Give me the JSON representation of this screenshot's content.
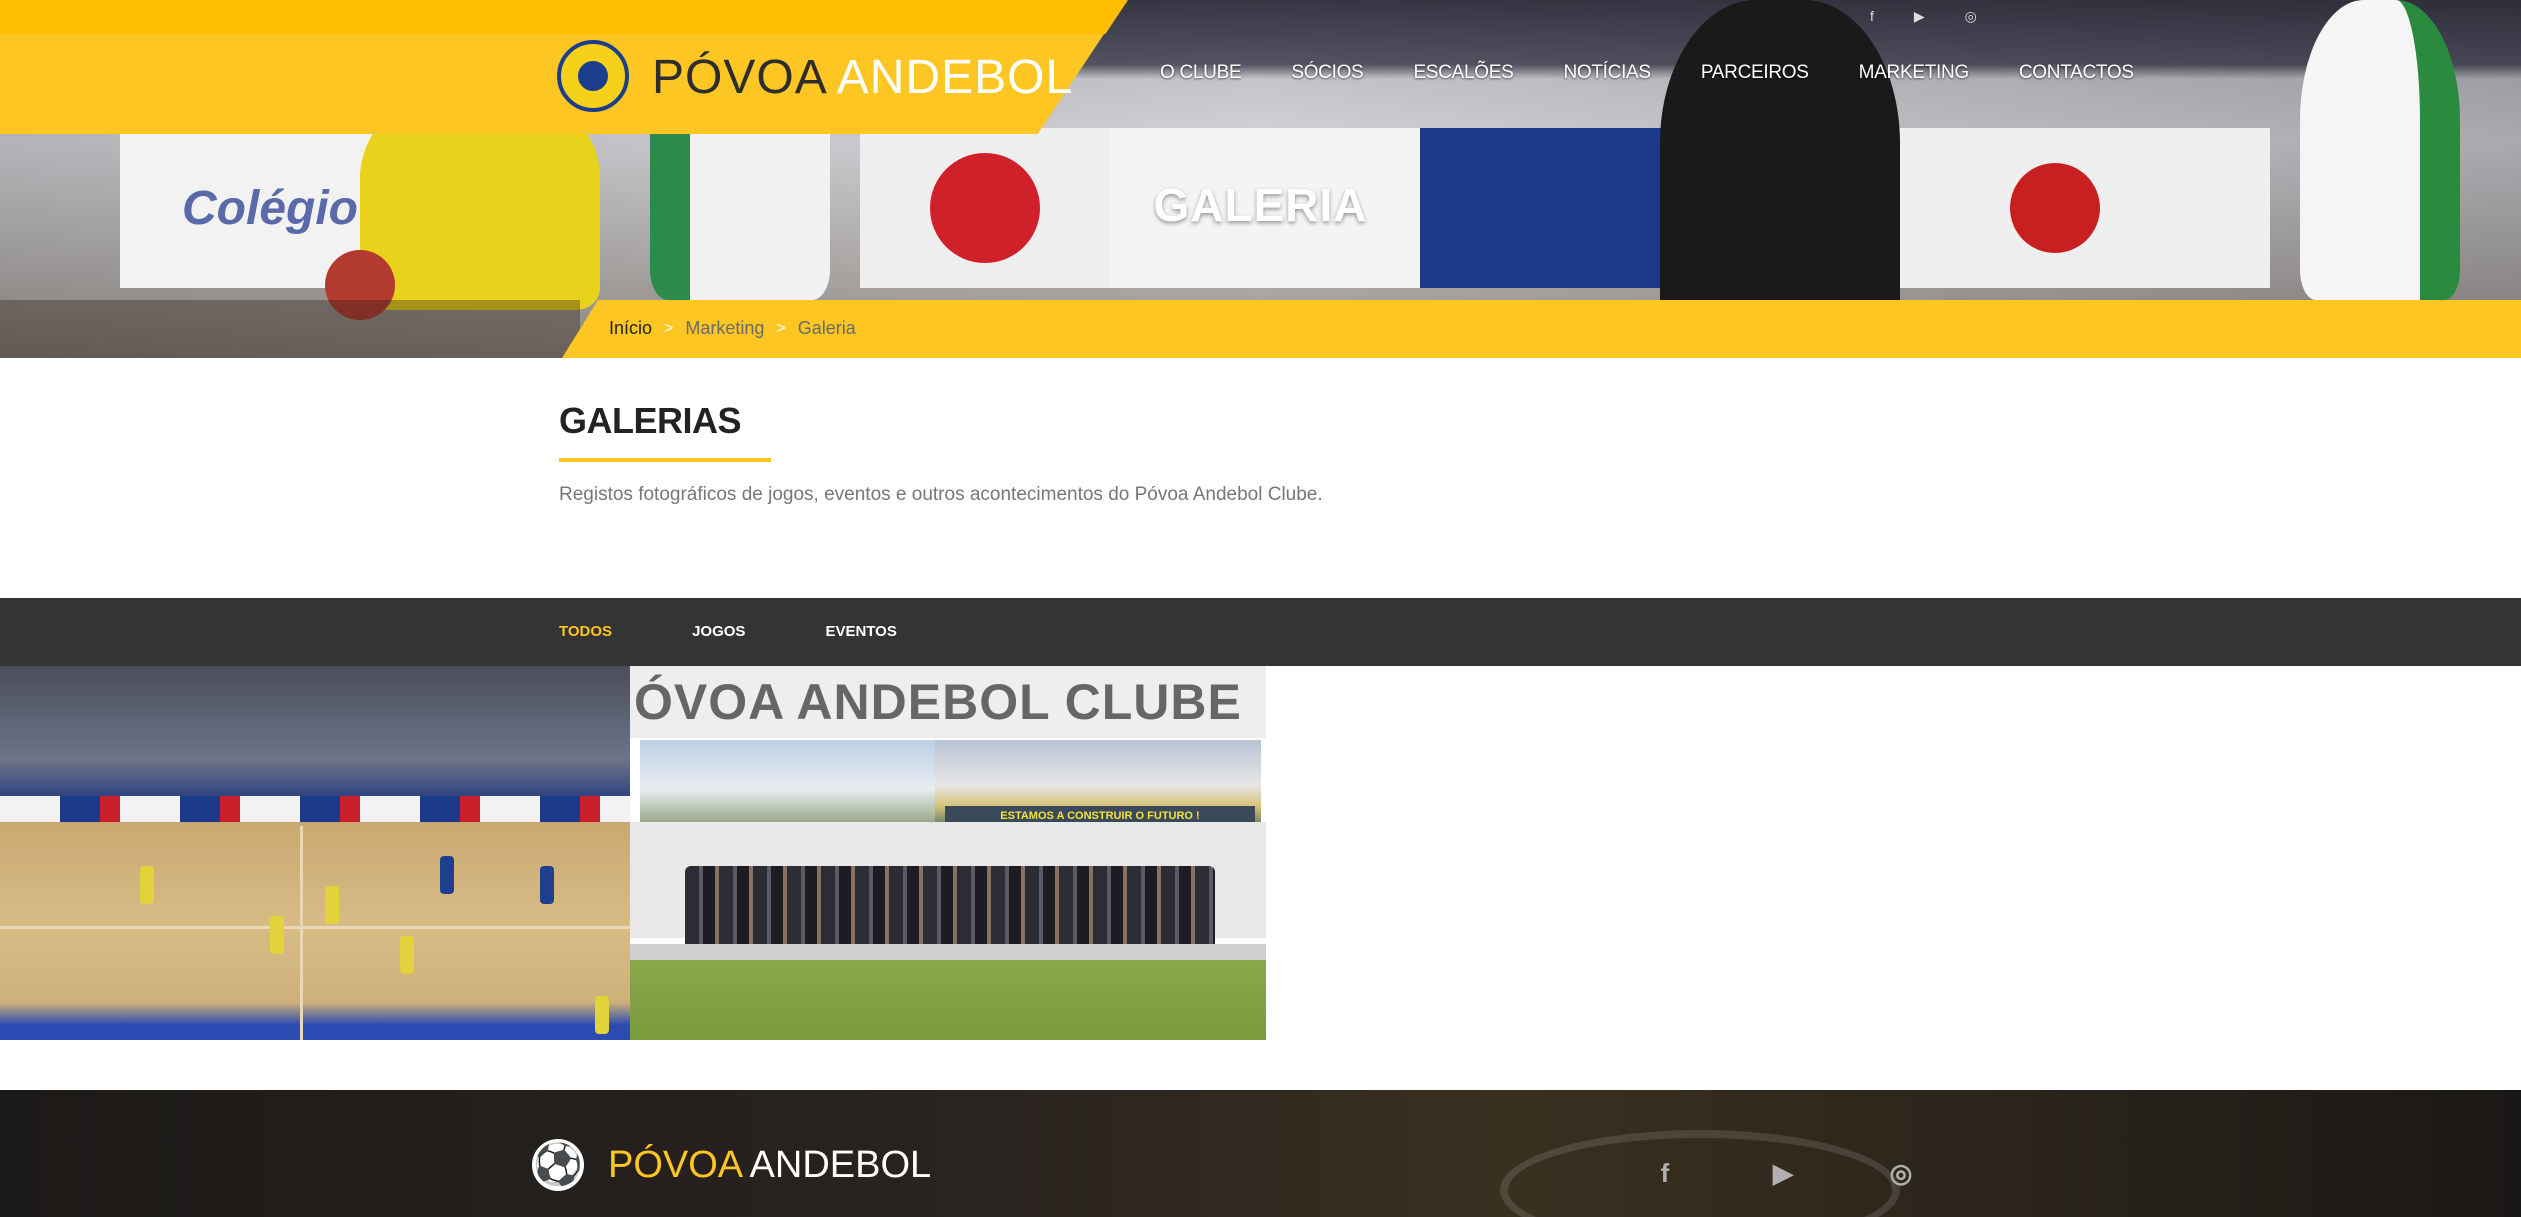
{
  "header": {
    "brand_part1": "PÓVOA",
    "brand_part2": "ANDEBOL",
    "nav": [
      {
        "label": "O CLUBE"
      },
      {
        "label": "SÓCIOS"
      },
      {
        "label": "ESCALÕES"
      },
      {
        "label": "NOTÍCIAS"
      },
      {
        "label": "PARCEIROS"
      },
      {
        "label": "MARKETING"
      },
      {
        "label": "CONTACTOS"
      }
    ],
    "top_social_icons": [
      "facebook-icon",
      "youtube-icon",
      "instagram-icon"
    ]
  },
  "hero": {
    "title": "GALERIA",
    "breadcrumb": [
      "Início",
      "Marketing",
      "Galeria"
    ],
    "separator": ">"
  },
  "intro": {
    "title": "GALERIAS",
    "description": "Registos fotográficos de jogos, eventos e outros acontecimentos do Póvoa Andebol Clube."
  },
  "filters": [
    {
      "label": "TODOS",
      "active": true
    },
    {
      "label": "JOGOS",
      "active": false
    },
    {
      "label": "EVENTOS",
      "active": false
    }
  ],
  "gallery": {
    "item2_header": "ÓVOA ANDEBOL CLUBE",
    "item2_slogan": "ESTAMOS A CONSTRUIR O FUTURO !"
  },
  "footer": {
    "brand_part1": "PÓVOA",
    "brand_part2": "ANDEBOL",
    "social_icons": [
      "facebook-icon",
      "youtube-icon",
      "instagram-icon"
    ]
  },
  "colors": {
    "accent": "#fec622",
    "dark_bar": "#343434",
    "text_muted": "#777777"
  }
}
